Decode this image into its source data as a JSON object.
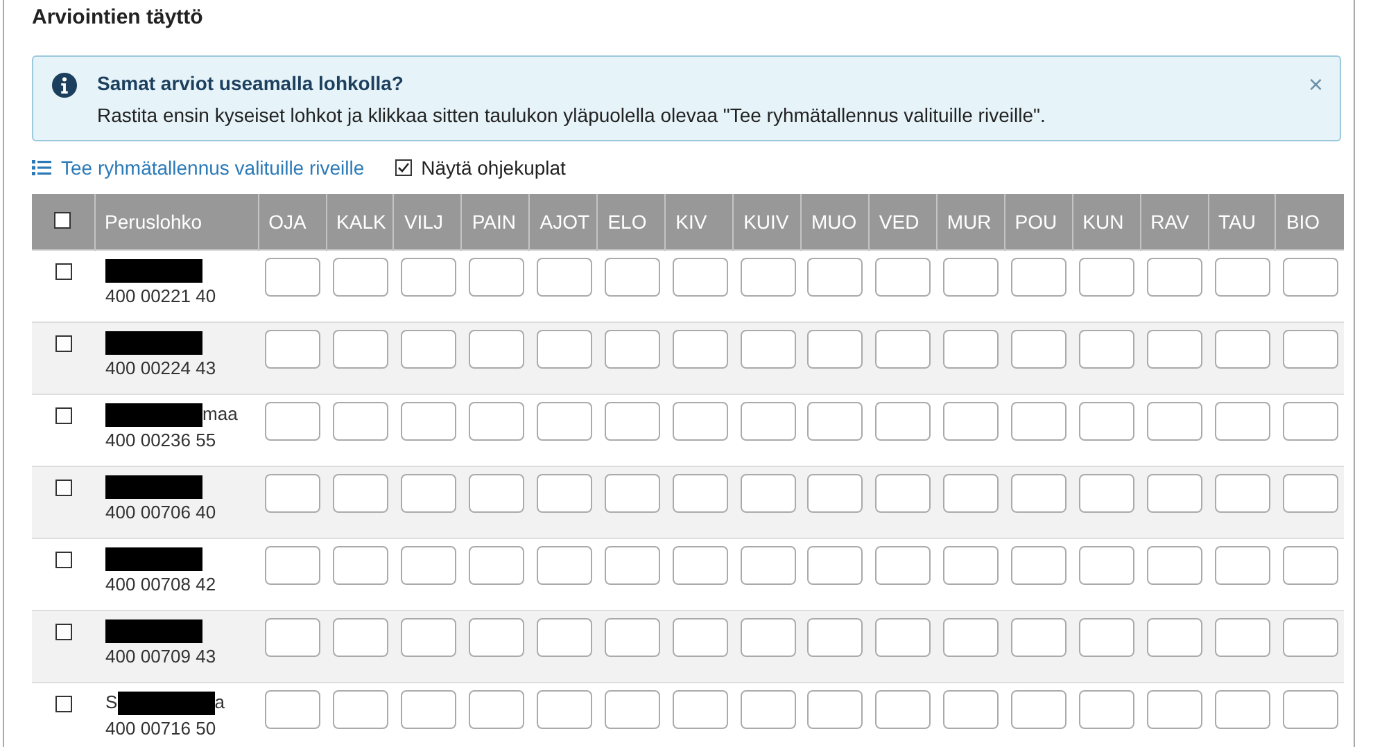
{
  "title": "Arviointien täyttö",
  "notice": {
    "heading": "Samat arviot useamalla lohkolla?",
    "text": "Rastita ensin kyseiset lohkot ja klikkaa sitten taulukon yläpuolella olevaa \"Tee ryhmätallennus valituille riveille\".",
    "close": "×"
  },
  "toolbar": {
    "group_save": "Tee ryhmätallennus valituille riveille",
    "show_tips": {
      "label": "Näytä ohjekuplat",
      "checked": true
    }
  },
  "table": {
    "select_all_checked": false,
    "columns": [
      "Peruslohko",
      "OJA",
      "KALK",
      "VILJ",
      "PAIN",
      "AJOT",
      "ELO",
      "KIV",
      "KUIV",
      "MUO",
      "VED",
      "MUR",
      "POU",
      "KUN",
      "RAV",
      "TAU",
      "BIO"
    ],
    "rows": [
      {
        "checked": false,
        "name_before": "",
        "name_after": "",
        "code": "400 00221 40"
      },
      {
        "checked": false,
        "name_before": "",
        "name_after": "",
        "code": "400 00224 43"
      },
      {
        "checked": false,
        "name_before": "",
        "name_after": "maa",
        "code": "400 00236 55"
      },
      {
        "checked": false,
        "name_before": "",
        "name_after": "",
        "code": "400 00706 40"
      },
      {
        "checked": false,
        "name_before": "",
        "name_after": "",
        "code": "400 00708 42"
      },
      {
        "checked": false,
        "name_before": "",
        "name_after": "",
        "code": "400 00709 43"
      },
      {
        "checked": false,
        "name_before": "S",
        "name_after": "a",
        "code": "400 00716 50"
      }
    ]
  }
}
